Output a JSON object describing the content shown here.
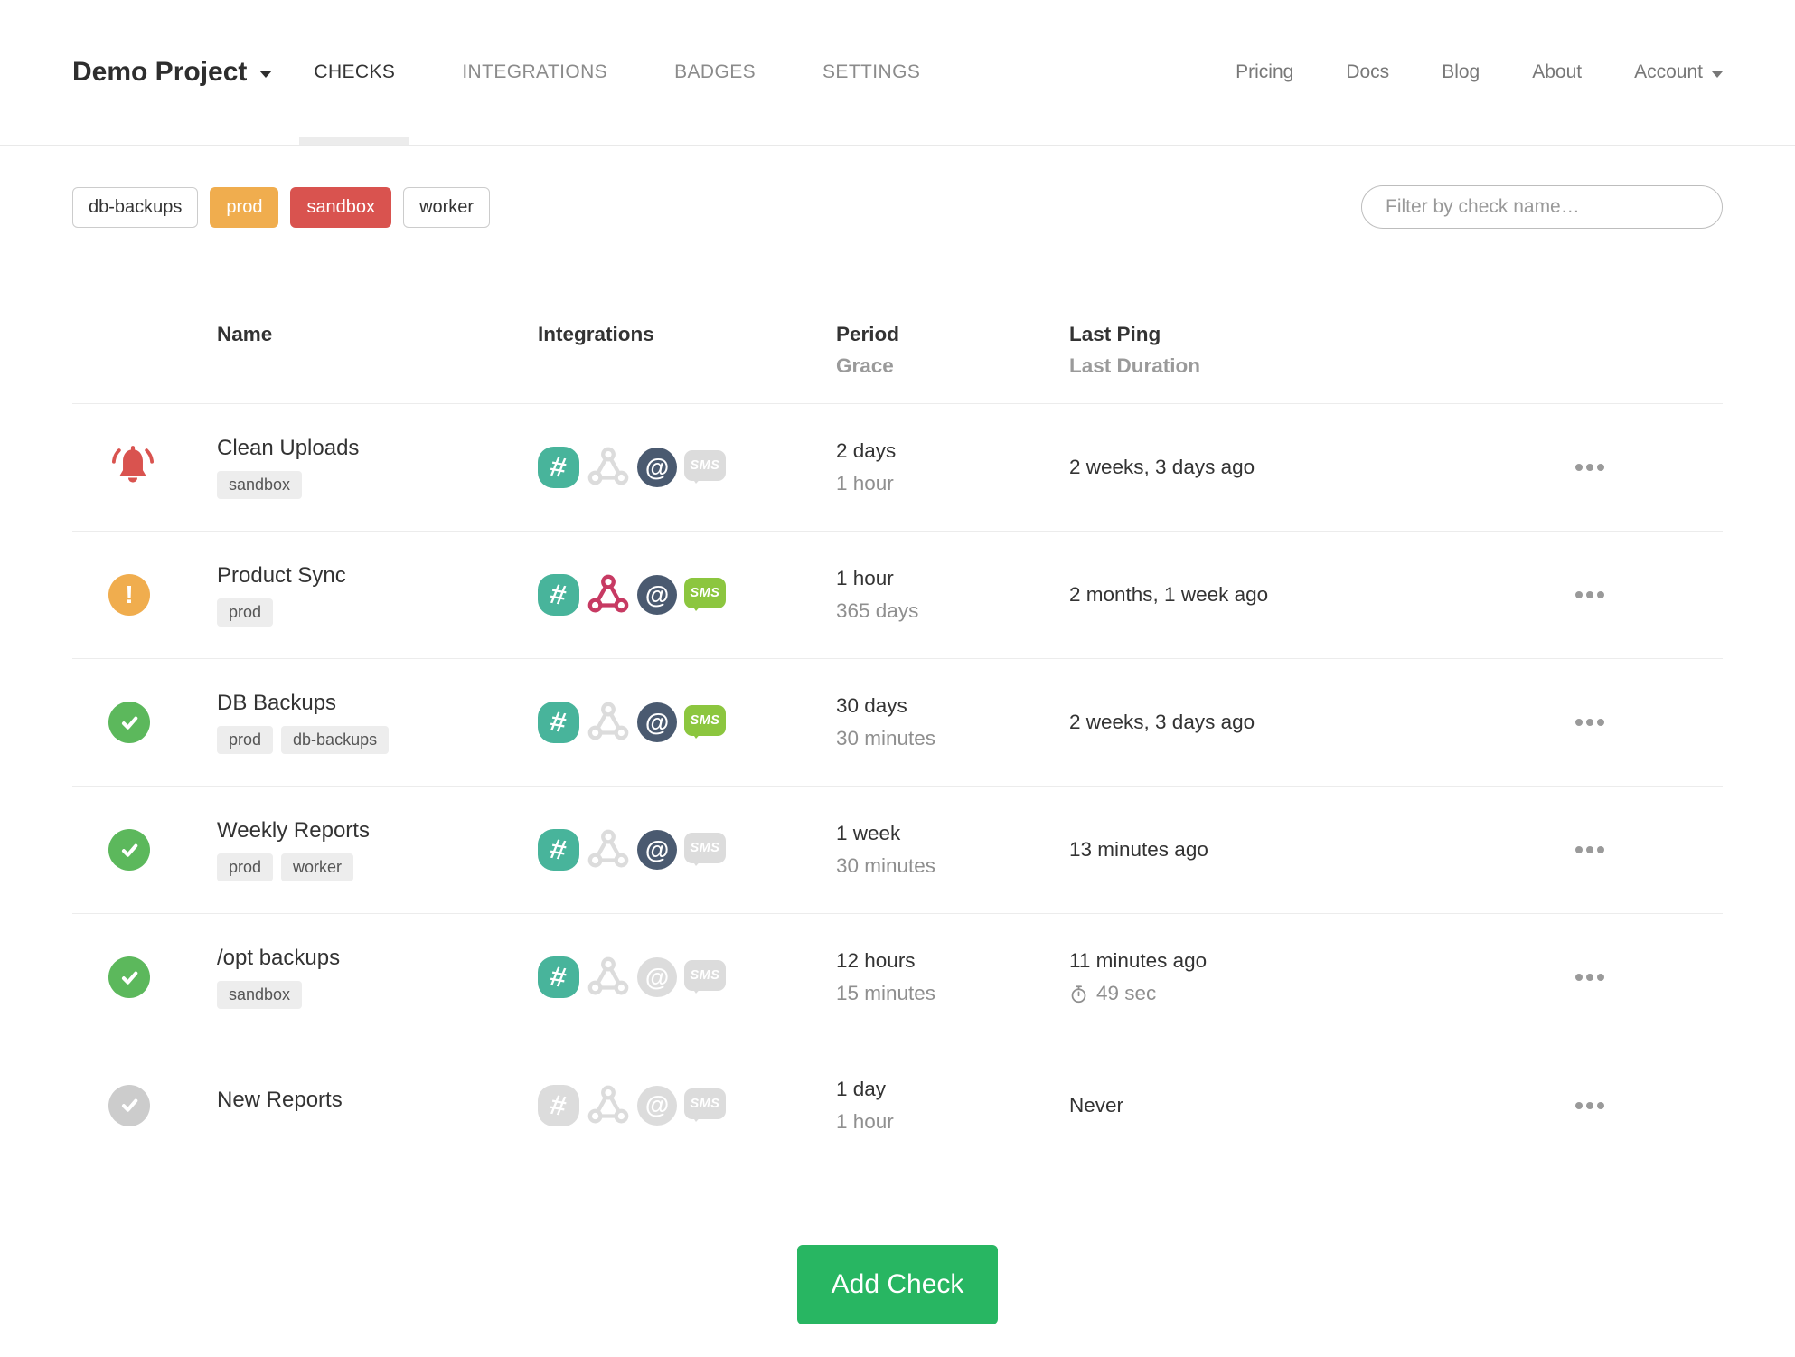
{
  "header": {
    "project_name": "Demo Project",
    "tabs": [
      {
        "label": "CHECKS",
        "active": true
      },
      {
        "label": "INTEGRATIONS",
        "active": false
      },
      {
        "label": "BADGES",
        "active": false
      },
      {
        "label": "SETTINGS",
        "active": false
      }
    ],
    "links": [
      {
        "label": "Pricing"
      },
      {
        "label": "Docs"
      },
      {
        "label": "Blog"
      },
      {
        "label": "About"
      }
    ],
    "account": {
      "label": "Account"
    }
  },
  "filter_bar": {
    "tag_buttons": [
      {
        "label": "db-backups",
        "variant": "outline"
      },
      {
        "label": "prod",
        "variant": "orange"
      },
      {
        "label": "sandbox",
        "variant": "red"
      },
      {
        "label": "worker",
        "variant": "outline"
      }
    ],
    "search": {
      "placeholder": "Filter by check name…"
    }
  },
  "table": {
    "headers": {
      "name": "Name",
      "integrations": "Integrations",
      "period": "Period",
      "grace": "Grace",
      "last_ping": "Last Ping",
      "last_duration": "Last Duration"
    },
    "rows": [
      {
        "status": "alert",
        "name": "Clean Uploads",
        "tags": [
          "sandbox"
        ],
        "integrations": [
          {
            "name": "slack",
            "active": true
          },
          {
            "name": "webhook",
            "active": false
          },
          {
            "name": "email",
            "active": true
          },
          {
            "name": "sms",
            "active": false
          }
        ],
        "period": "2 days",
        "grace": "1 hour",
        "last_ping": "2 weeks, 3 days ago",
        "last_duration": null
      },
      {
        "status": "grace",
        "name": "Product Sync",
        "tags": [
          "prod"
        ],
        "integrations": [
          {
            "name": "slack",
            "active": true
          },
          {
            "name": "webhook",
            "active": true
          },
          {
            "name": "email",
            "active": true
          },
          {
            "name": "sms",
            "active": true
          }
        ],
        "period": "1 hour",
        "grace": "365 days",
        "last_ping": "2 months, 1 week ago",
        "last_duration": null
      },
      {
        "status": "up",
        "name": "DB Backups",
        "tags": [
          "prod",
          "db-backups"
        ],
        "integrations": [
          {
            "name": "slack",
            "active": true
          },
          {
            "name": "webhook",
            "active": false
          },
          {
            "name": "email",
            "active": true
          },
          {
            "name": "sms",
            "active": true
          }
        ],
        "period": "30 days",
        "grace": "30 minutes",
        "last_ping": "2 weeks, 3 days ago",
        "last_duration": null
      },
      {
        "status": "up",
        "name": "Weekly Reports",
        "tags": [
          "prod",
          "worker"
        ],
        "integrations": [
          {
            "name": "slack",
            "active": true
          },
          {
            "name": "webhook",
            "active": false
          },
          {
            "name": "email",
            "active": true
          },
          {
            "name": "sms",
            "active": false
          }
        ],
        "period": "1 week",
        "grace": "30 minutes",
        "last_ping": "13 minutes ago",
        "last_duration": null
      },
      {
        "status": "up",
        "name": "/opt backups",
        "tags": [
          "sandbox"
        ],
        "integrations": [
          {
            "name": "slack",
            "active": true
          },
          {
            "name": "webhook",
            "active": false
          },
          {
            "name": "email",
            "active": false
          },
          {
            "name": "sms",
            "active": false
          }
        ],
        "period": "12 hours",
        "grace": "15 minutes",
        "last_ping": "11 minutes ago",
        "last_duration": "49 sec"
      },
      {
        "status": "new",
        "name": "New Reports",
        "tags": [],
        "integrations": [
          {
            "name": "slack",
            "active": false
          },
          {
            "name": "webhook",
            "active": false
          },
          {
            "name": "email",
            "active": false
          },
          {
            "name": "sms",
            "active": false
          }
        ],
        "period": "1 day",
        "grace": "1 hour",
        "last_ping": "Never",
        "last_duration": null
      }
    ]
  },
  "add_check": {
    "label": "Add Check"
  },
  "colors": {
    "status_alert": "#d9534f",
    "status_grace": "#f0ad4e",
    "status_up": "#5cb85c",
    "status_new": "#cccccc",
    "tag_orange": "#f0ad4e",
    "tag_red": "#d9534f",
    "slack": "#48b49b",
    "webhook": "#c73a63",
    "email": "#4a5a70",
    "sms": "#8cc63f",
    "inactive_icon": "#dddddd",
    "add_button": "#28b662"
  }
}
